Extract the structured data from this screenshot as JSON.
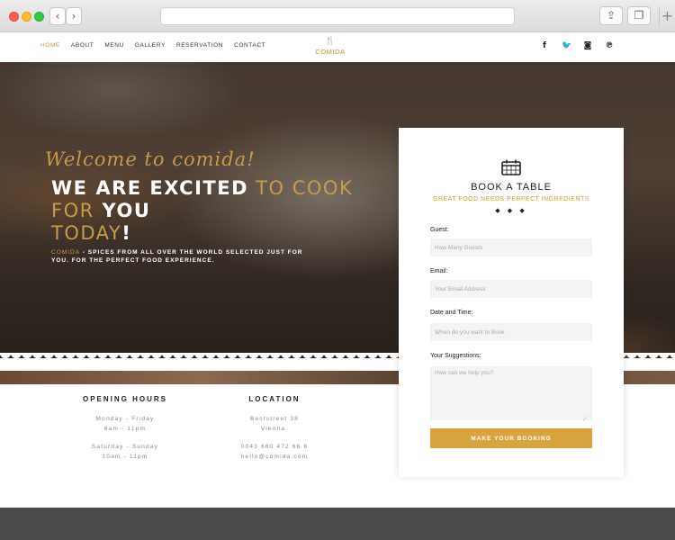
{
  "browser": {
    "back_icon": "chevron-left-icon",
    "forward_icon": "chevron-right-icon",
    "share_icon": "share-icon",
    "tabs_icon": "tabs-icon",
    "new_tab_icon": "plus-icon"
  },
  "nav": {
    "items": [
      "HOME",
      "ABOUT",
      "MENU",
      "GALLERY",
      "RESERVATION",
      "CONTACT"
    ],
    "active": "HOME",
    "logo_text": "COMIDA",
    "logo_icon": "fork-knife-icon",
    "social": [
      "facebook-icon",
      "twitter-icon",
      "instagram-icon",
      "pinterest-icon"
    ]
  },
  "hero": {
    "welcome": "Welcome to comida!",
    "headline": {
      "part1": "WE ARE EXCITED",
      "part2": " TO COOK FOR",
      "part3": " YOU",
      "part4": " TODAY",
      "part5": "!"
    },
    "tagline": {
      "brand": "COMIDA",
      "text": " - SPICES FROM ALL OVER THE WORLD SELECTED JUST FOR YOU. FOR THE PERFECT FOOD EXPERIENCE."
    }
  },
  "info": {
    "hours": {
      "title": "OPENING HOURS",
      "weekday_days": "Monday - Friday",
      "weekday_time": "8am - 11pm",
      "weekend_days": "Saturday - Sunday",
      "weekend_time": "10am - 11pm"
    },
    "location": {
      "title": "LOCATION",
      "street": "Beststreet 38",
      "city": "Vienna.",
      "phone": "0043 660 472 66 8",
      "email": "hello@comida.com"
    }
  },
  "booking": {
    "icon": "calendar-icon",
    "title": "BOOK A TABLE",
    "subtitle": "GREAT FOOD NEEDS PERFECT INGREDIENTS",
    "divider": "◆ ◆ ◆",
    "guest_label": "Guest:",
    "guest_placeholder": "How Many Guests",
    "email_label": "Email:",
    "email_placeholder": "Your Email Address",
    "date_label": "Date and Time:",
    "date_placeholder": "When do you want to Book",
    "suggestions_label": "Your Suggestions:",
    "suggestions_placeholder": "How can we help you?",
    "submit_label": "MAKE YOUR BOOKING",
    "accent_color": "#d8a440"
  }
}
